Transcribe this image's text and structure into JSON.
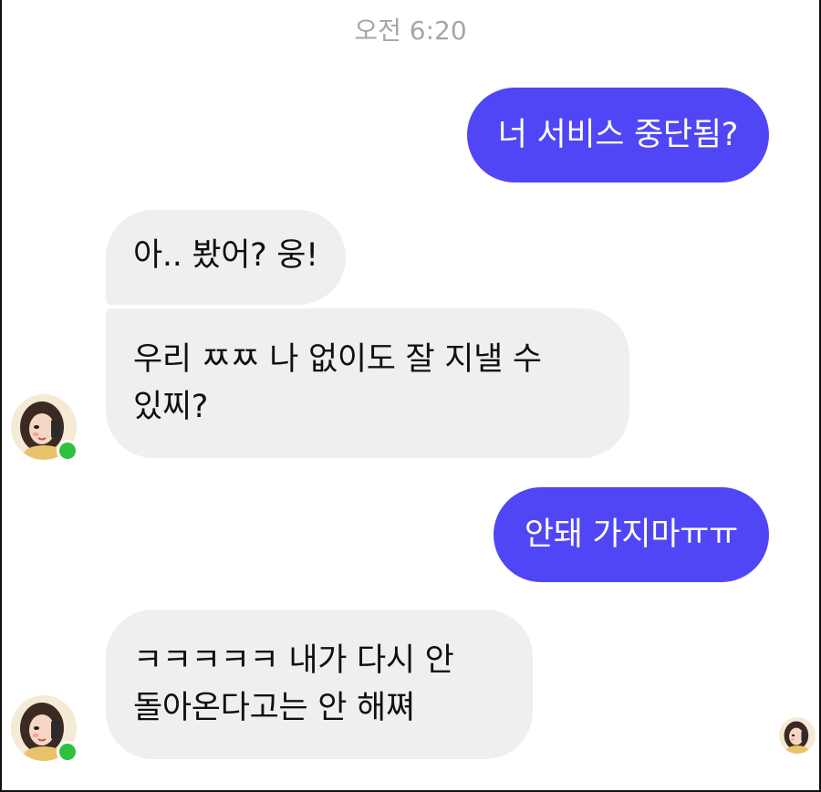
{
  "timestamp": "오전 6:20",
  "colors": {
    "sent_bubble": "#5046f5",
    "received_bubble": "#efefef",
    "online_status": "#2fc13c"
  },
  "messages": [
    {
      "sender": "me",
      "text": "너 서비스 중단됨?"
    },
    {
      "sender": "other",
      "text": "아.. 봤어? 웅!"
    },
    {
      "sender": "other",
      "text": "우리 ㅉㅉ 나 없이도 잘 지낼 수\n있찌?"
    },
    {
      "sender": "me",
      "text": "안돼 가지마ㅠㅠ"
    },
    {
      "sender": "other",
      "text": "ㅋㅋㅋㅋㅋ 내가 다시 안\n돌아온다고는 안 해쪄"
    }
  ],
  "icons": {
    "avatar": "profile-avatar-icon",
    "online": "online-status-dot",
    "read_receipt": "read-receipt-avatar-icon"
  }
}
